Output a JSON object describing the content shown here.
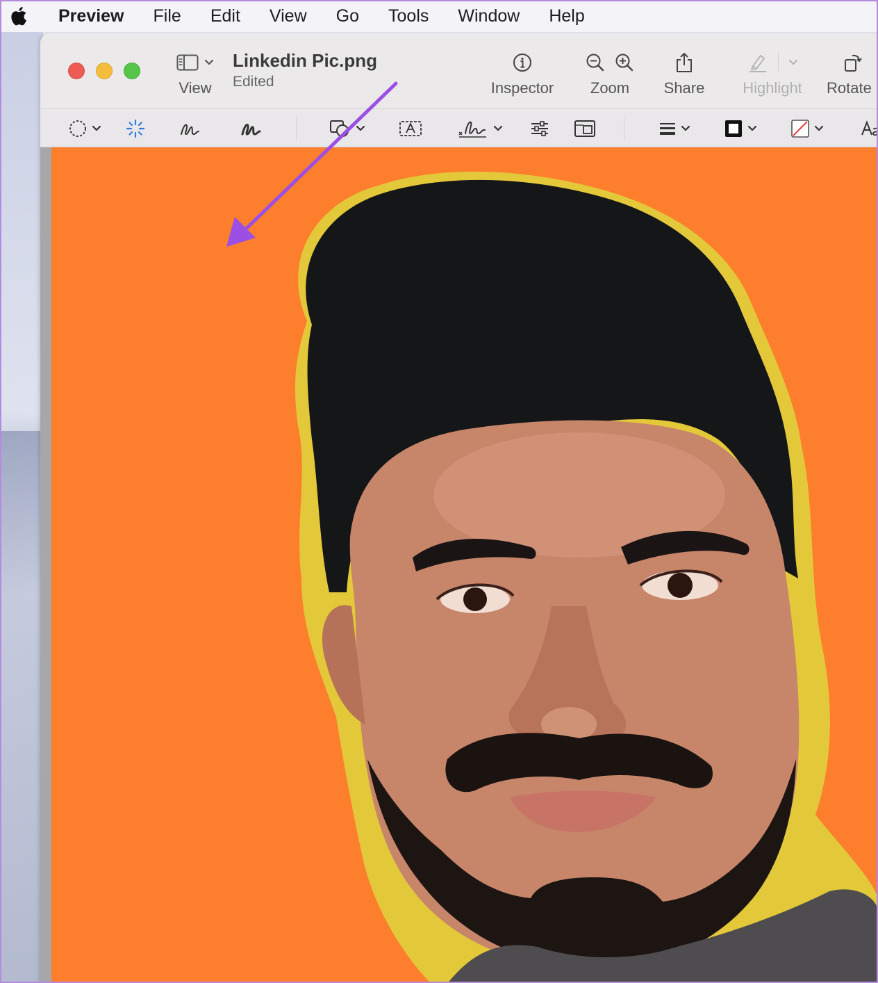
{
  "menubar": {
    "app_name": "Preview",
    "items": [
      "File",
      "Edit",
      "View",
      "Go",
      "Tools",
      "Window",
      "Help"
    ]
  },
  "window": {
    "title": "Linkedin Pic.png",
    "subtitle": "Edited",
    "toolbar": {
      "view_label": "View",
      "inspector_label": "Inspector",
      "zoom_label": "Zoom",
      "share_label": "Share",
      "highlight_label": "Highlight",
      "rotate_label": "Rotate"
    },
    "markup_tools": [
      "selection-tools-icon",
      "instant-alpha-icon",
      "sketch-icon",
      "draw-icon",
      "shapes-icon",
      "text-box-icon",
      "sign-icon",
      "adjust-color-icon",
      "adjust-size-icon",
      "shape-style-icon",
      "border-color-icon",
      "fill-color-icon",
      "text-style-icon"
    ]
  },
  "colors": {
    "canvas_background": "#fd7e2c",
    "annotation_arrow": "#9b4fe5",
    "accent_blue": "#2e7be0"
  }
}
